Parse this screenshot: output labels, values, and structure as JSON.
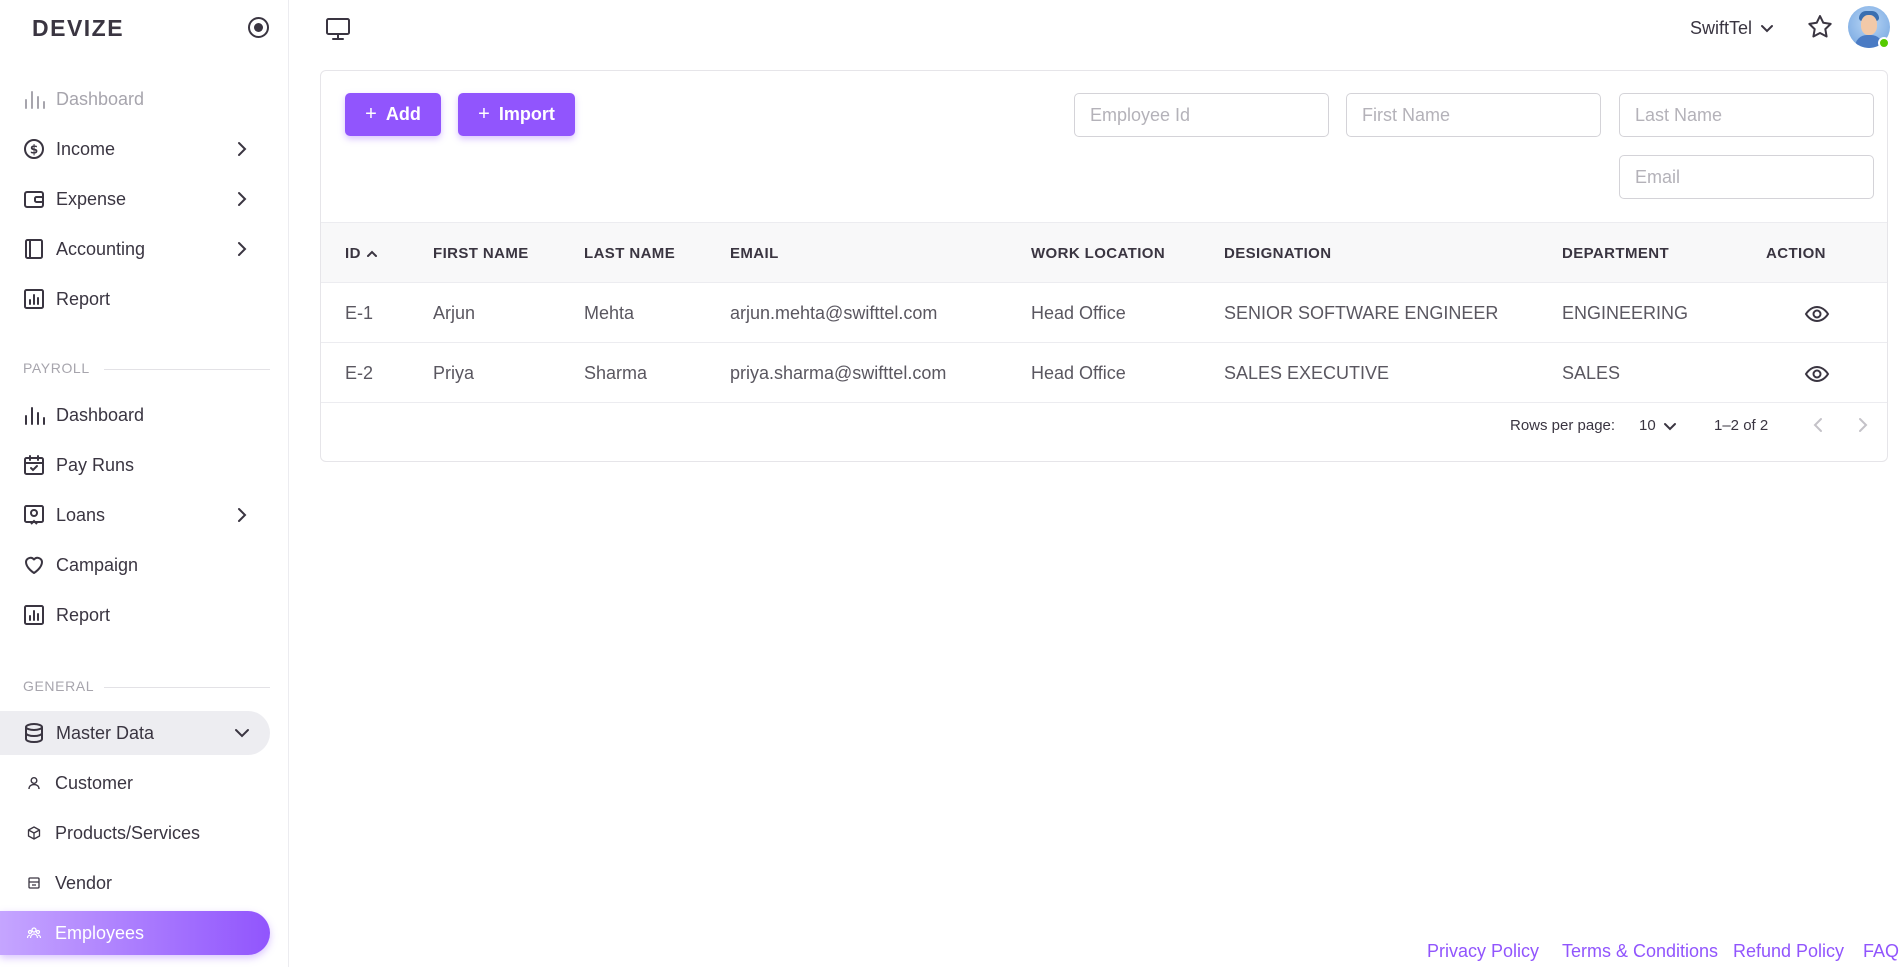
{
  "brand": "DEVIZE",
  "sidebar": {
    "top_items": [
      {
        "label": "Dashboard",
        "icon": "bar-chart-icon"
      },
      {
        "label": "Income",
        "icon": "dollar-circle-icon"
      },
      {
        "label": "Expense",
        "icon": "wallet-icon"
      },
      {
        "label": "Accounting",
        "icon": "ledger-icon"
      },
      {
        "label": "Report",
        "icon": "report-chart-icon"
      }
    ],
    "payroll_label": "PAYROLL",
    "payroll_items": [
      {
        "label": "Dashboard",
        "icon": "bar-chart-icon"
      },
      {
        "label": "Pay Runs",
        "icon": "calendar-check-icon"
      },
      {
        "label": "Loans",
        "icon": "loan-icon"
      },
      {
        "label": "Campaign",
        "icon": "heart-icon"
      },
      {
        "label": "Report",
        "icon": "report-chart-icon"
      }
    ],
    "general_label": "GENERAL",
    "master_data": {
      "label": "Master Data",
      "icon": "database-icon"
    },
    "master_children": [
      {
        "label": "Customer",
        "icon": "person-icon"
      },
      {
        "label": "Products/Services",
        "icon": "cube-icon"
      },
      {
        "label": "Vendor",
        "icon": "store-icon"
      },
      {
        "label": "Employees",
        "icon": "employees-icon"
      }
    ]
  },
  "topbar": {
    "company": "SwiftTel"
  },
  "toolbar": {
    "add_label": "Add",
    "import_label": "Import"
  },
  "filters": {
    "employee_id_placeholder": "Employee Id",
    "first_name_placeholder": "First Name",
    "last_name_placeholder": "Last Name",
    "email_placeholder": "Email"
  },
  "table": {
    "columns": [
      "ID",
      "FIRST NAME",
      "LAST NAME",
      "EMAIL",
      "WORK LOCATION",
      "DESIGNATION",
      "DEPARTMENT",
      "ACTION"
    ],
    "rows": [
      {
        "id": "E-1",
        "first": "Arjun",
        "last": "Mehta",
        "email": "arjun.mehta@swifttel.com",
        "location": "Head Office",
        "designation": "SENIOR SOFTWARE ENGINEER",
        "department": "ENGINEERING"
      },
      {
        "id": "E-2",
        "first": "Priya",
        "last": "Sharma",
        "email": "priya.sharma@swifttel.com",
        "location": "Head Office",
        "designation": "SALES EXECUTIVE",
        "department": "SALES"
      }
    ]
  },
  "pagination": {
    "rows_per_page_label": "Rows per page:",
    "rows_per_page": "10",
    "range": "1–2 of 2"
  },
  "footer": {
    "privacy": "Privacy Policy",
    "terms": "Terms & Conditions",
    "refund": "Refund Policy",
    "faq": "FAQ"
  },
  "colors": {
    "primary": "#9155fd",
    "text": "#3a3541",
    "online": "#56ca00"
  }
}
